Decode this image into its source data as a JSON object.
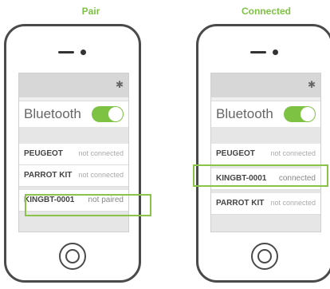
{
  "colors": {
    "accent": "#7dc242",
    "frame": "#4a4a4a",
    "highlight": "#8bc34a"
  },
  "left": {
    "heading": "Pair",
    "screen": {
      "bluetooth_label": "Bluetooth",
      "bluetooth_icon": "bluetooth-icon",
      "toggle_on": true,
      "devices": [
        {
          "name": "PEUGEOT",
          "status": "not connected"
        },
        {
          "name": "PARROT KIT",
          "status": "not connected"
        },
        {
          "name": "KINGBT-0001",
          "status": "not paired",
          "highlighted": true
        }
      ]
    }
  },
  "right": {
    "heading": "Connected",
    "screen": {
      "bluetooth_label": "Bluetooth",
      "bluetooth_icon": "bluetooth-icon",
      "toggle_on": true,
      "devices": [
        {
          "name": "PEUGEOT",
          "status": "not connected"
        },
        {
          "name": "KINGBT-0001",
          "status": "connected",
          "highlighted": true
        },
        {
          "name": "PARROT KIT",
          "status": "not connected"
        }
      ]
    }
  }
}
